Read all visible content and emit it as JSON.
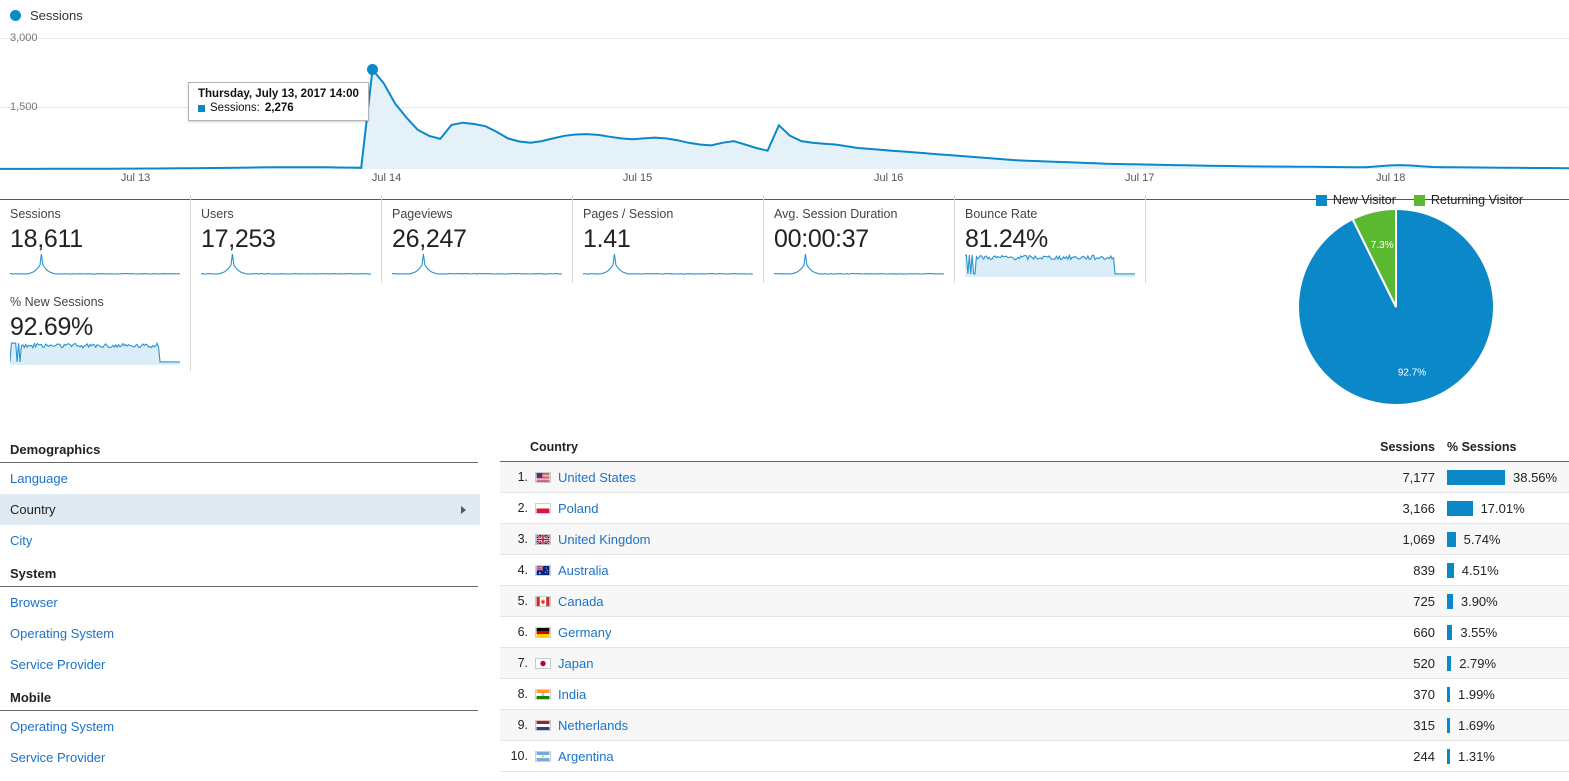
{
  "chart": {
    "legend_label": "Sessions",
    "legend_dot": "circle-dot-icon",
    "tooltip": {
      "title": "Thursday, July 13, 2017 14:00",
      "series_label": "Sessions:",
      "value": "2,276"
    },
    "yticks": [
      "3,000",
      "1,500"
    ],
    "xticks": [
      "Jul 13",
      "Jul 14",
      "Jul 15",
      "Jul 16",
      "Jul 17",
      "Jul 18"
    ],
    "accent_color": "#0a88c8",
    "fill_color": "#e4f1f8"
  },
  "chart_data": {
    "type": "area",
    "title": "Sessions",
    "xlabel": "",
    "ylabel": "Sessions",
    "ylim": [
      0,
      3000
    ],
    "yticks": [
      1500,
      3000
    ],
    "grid": true,
    "legend": [
      "Sessions"
    ],
    "x_tick_labels": [
      "Jul 13",
      "Jul 14",
      "Jul 15",
      "Jul 16",
      "Jul 17",
      "Jul 18"
    ],
    "annotation": "Thursday, July 13, 2017 14:00 — Sessions: 2,276",
    "peak": {
      "x": "Jul 13 14:00",
      "y": 2276
    },
    "x": [
      0,
      1,
      2,
      3,
      4,
      5,
      6,
      7,
      8,
      9,
      10,
      11,
      12,
      13,
      14,
      15,
      16,
      17,
      18,
      19,
      20,
      21,
      22,
      23,
      24,
      25,
      26,
      27,
      28,
      29,
      30,
      31,
      32,
      33,
      34,
      35,
      36,
      37,
      38,
      39,
      40,
      41,
      42,
      43,
      44,
      45,
      46,
      47,
      48,
      49,
      50,
      51,
      52,
      53,
      54,
      55,
      56,
      57,
      58,
      59,
      60,
      61,
      62,
      63,
      64,
      65,
      66,
      67,
      68,
      69,
      70,
      71,
      72,
      73,
      74,
      75,
      76,
      77,
      78,
      79,
      80,
      81,
      82,
      83,
      84,
      85,
      86,
      87,
      88,
      89,
      90,
      91,
      92,
      93,
      94,
      95,
      96,
      97,
      98,
      99,
      100,
      101,
      102,
      103,
      104,
      105,
      106,
      107,
      108,
      109,
      110,
      111,
      112,
      113,
      114,
      115,
      116,
      117,
      118,
      119,
      120,
      121,
      122,
      123,
      124,
      125,
      126,
      127,
      128,
      129,
      130,
      131,
      132,
      133,
      134,
      135
    ],
    "values": [
      2,
      2,
      3,
      3,
      4,
      4,
      5,
      6,
      6,
      7,
      8,
      9,
      10,
      11,
      12,
      14,
      16,
      18,
      20,
      23,
      26,
      30,
      33,
      36,
      38,
      40,
      41,
      41,
      40,
      38,
      35,
      32,
      28,
      2276,
      1960,
      1500,
      1180,
      900,
      760,
      690,
      1010,
      1060,
      1030,
      980,
      850,
      700,
      630,
      600,
      640,
      700,
      760,
      790,
      800,
      780,
      740,
      700,
      680,
      700,
      720,
      700,
      660,
      600,
      560,
      540,
      600,
      640,
      560,
      480,
      420,
      1000,
      760,
      640,
      600,
      580,
      560,
      520,
      480,
      460,
      440,
      420,
      400,
      380,
      360,
      340,
      320,
      300,
      280,
      260,
      240,
      220,
      200,
      190,
      180,
      170,
      160,
      150,
      140,
      130,
      120,
      115,
      110,
      105,
      100,
      95,
      90,
      85,
      80,
      76,
      72,
      68,
      64,
      60,
      58,
      56,
      54,
      52,
      50,
      48,
      46,
      44,
      42,
      40,
      60,
      80,
      90,
      80,
      60,
      45,
      40,
      38,
      36,
      34,
      32,
      30,
      28,
      26,
      24,
      22,
      20,
      18
    ]
  },
  "metrics": [
    {
      "label": "Sessions",
      "value": "18,611"
    },
    {
      "label": "Users",
      "value": "17,253"
    },
    {
      "label": "Pageviews",
      "value": "26,247"
    },
    {
      "label": "Pages / Session",
      "value": "1.41"
    },
    {
      "label": "Avg. Session Duration",
      "value": "00:00:37"
    },
    {
      "label": "Bounce Rate",
      "value": "81.24%"
    },
    {
      "label": "% New Sessions",
      "value": "92.69%"
    }
  ],
  "pie": {
    "legend": [
      {
        "label": "New Visitor",
        "color": "#0a88c8"
      },
      {
        "label": "Returning Visitor",
        "color": "#5ab831"
      }
    ],
    "slices": [
      {
        "label": "New Visitor",
        "percent_text": "92.7%",
        "value": 92.7,
        "color": "#0a88c8"
      },
      {
        "label": "Returning Visitor",
        "percent_text": "7.3%",
        "value": 7.3,
        "color": "#5ab831"
      }
    ]
  },
  "sidebar": {
    "groups": [
      {
        "title": "Demographics",
        "items": [
          {
            "label": "Language",
            "selected": false
          },
          {
            "label": "Country",
            "selected": true
          },
          {
            "label": "City",
            "selected": false
          }
        ]
      },
      {
        "title": "System",
        "items": [
          {
            "label": "Browser",
            "selected": false
          },
          {
            "label": "Operating System",
            "selected": false
          },
          {
            "label": "Service Provider",
            "selected": false
          }
        ]
      },
      {
        "title": "Mobile",
        "items": [
          {
            "label": "Operating System",
            "selected": false
          },
          {
            "label": "Service Provider",
            "selected": false
          }
        ]
      }
    ]
  },
  "table": {
    "headers": {
      "country": "Country",
      "sessions": "Sessions",
      "pct_sessions": "% Sessions"
    },
    "rows": [
      {
        "rank": "1.",
        "country": "United States",
        "flag": "flag-us-icon",
        "sessions": "7,177",
        "pct_text": "38.56%",
        "pct": 38.56
      },
      {
        "rank": "2.",
        "country": "Poland",
        "flag": "flag-pl-icon",
        "sessions": "3,166",
        "pct_text": "17.01%",
        "pct": 17.01
      },
      {
        "rank": "3.",
        "country": "United Kingdom",
        "flag": "flag-gb-icon",
        "sessions": "1,069",
        "pct_text": "5.74%",
        "pct": 5.74
      },
      {
        "rank": "4.",
        "country": "Australia",
        "flag": "flag-au-icon",
        "sessions": "839",
        "pct_text": "4.51%",
        "pct": 4.51
      },
      {
        "rank": "5.",
        "country": "Canada",
        "flag": "flag-ca-icon",
        "sessions": "725",
        "pct_text": "3.90%",
        "pct": 3.9
      },
      {
        "rank": "6.",
        "country": "Germany",
        "flag": "flag-de-icon",
        "sessions": "660",
        "pct_text": "3.55%",
        "pct": 3.55
      },
      {
        "rank": "7.",
        "country": "Japan",
        "flag": "flag-jp-icon",
        "sessions": "520",
        "pct_text": "2.79%",
        "pct": 2.79
      },
      {
        "rank": "8.",
        "country": "India",
        "flag": "flag-in-icon",
        "sessions": "370",
        "pct_text": "1.99%",
        "pct": 1.99
      },
      {
        "rank": "9.",
        "country": "Netherlands",
        "flag": "flag-nl-icon",
        "sessions": "315",
        "pct_text": "1.69%",
        "pct": 1.69
      },
      {
        "rank": "10.",
        "country": "Argentina",
        "flag": "flag-ar-icon",
        "sessions": "244",
        "pct_text": "1.31%",
        "pct": 1.31
      }
    ]
  }
}
